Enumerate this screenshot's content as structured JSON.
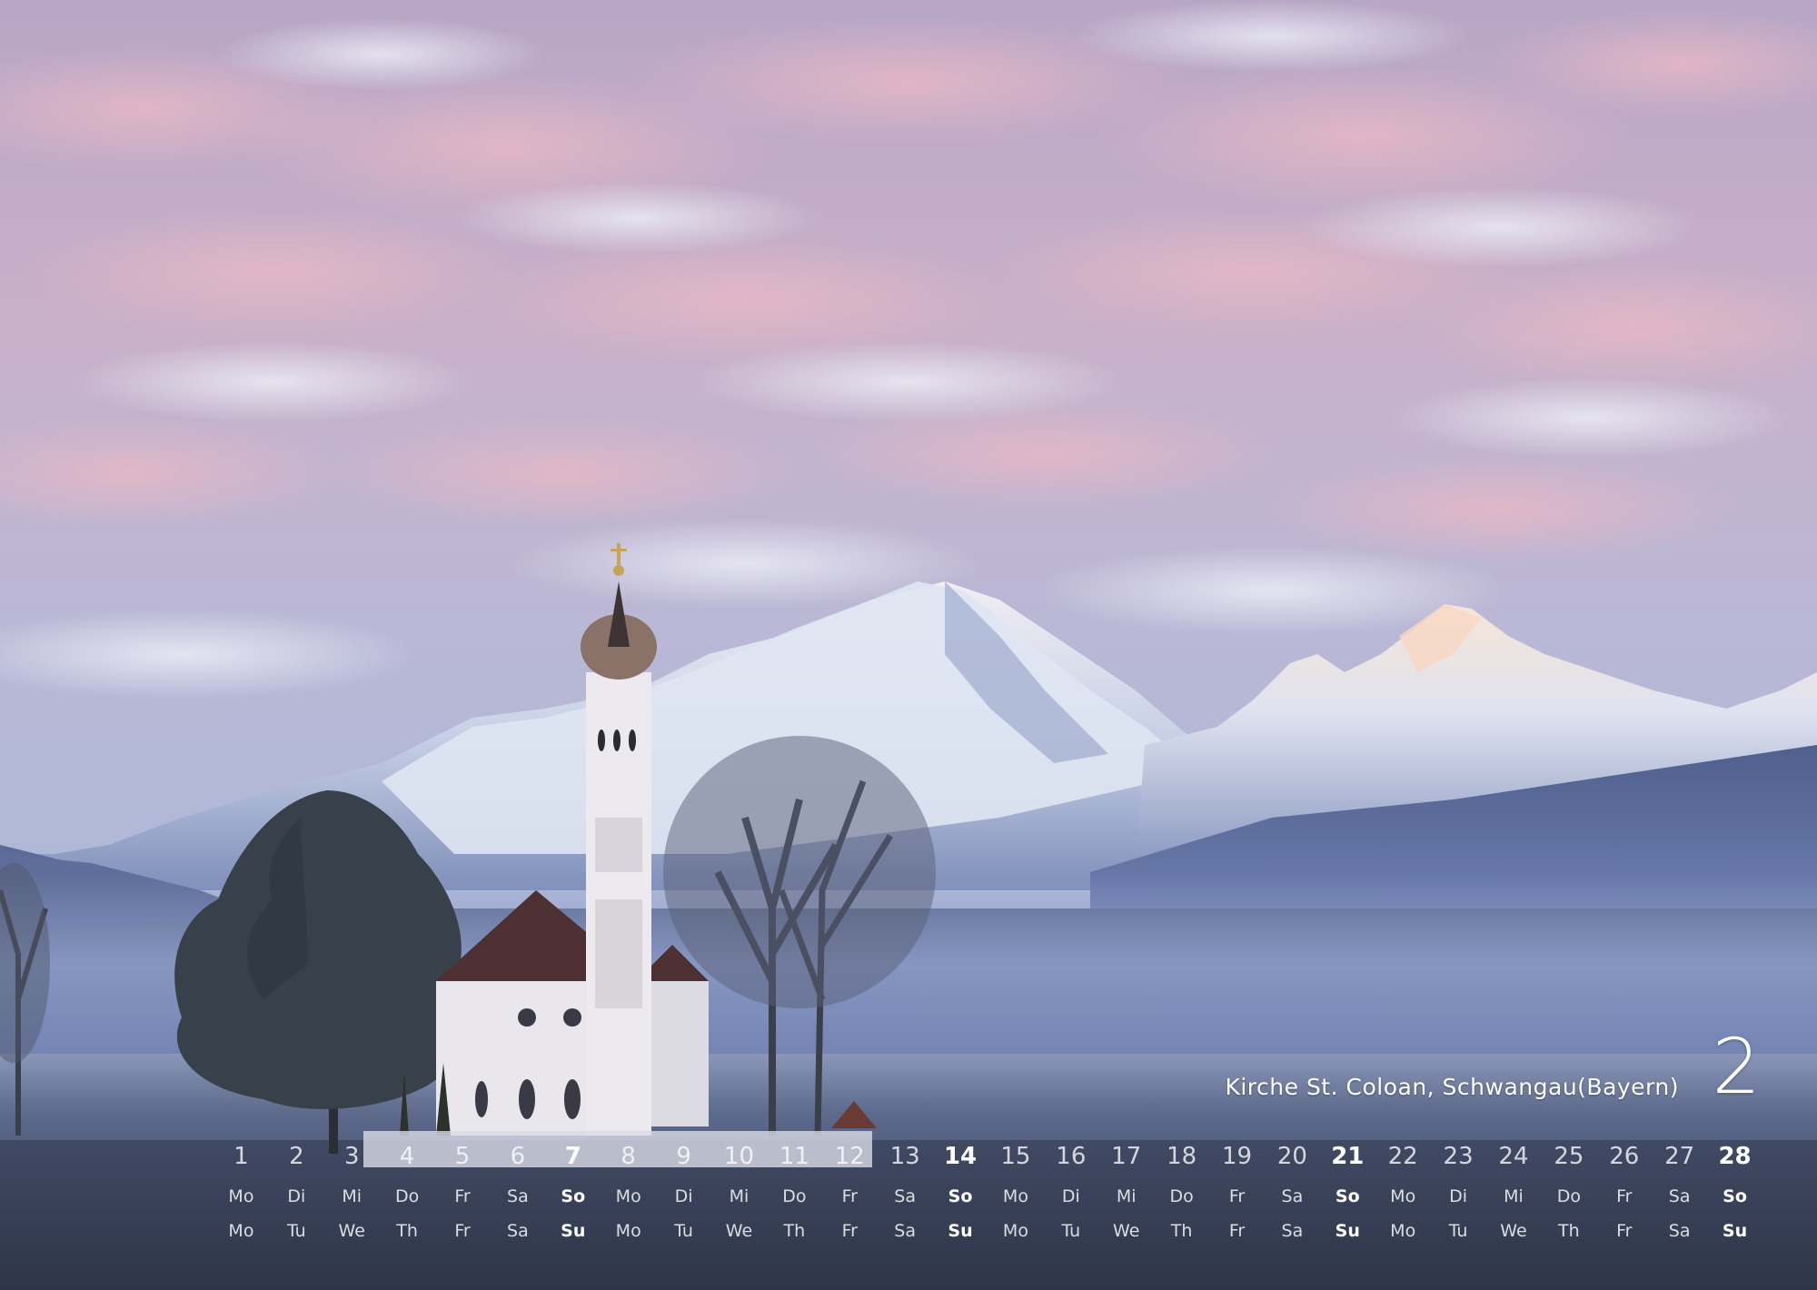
{
  "photo": {
    "caption": "Kirche St. Coloan, Schwangau(Bayern)"
  },
  "calendar": {
    "month_number": "2",
    "days": [
      "1",
      "2",
      "3",
      "4",
      "5",
      "6",
      "7",
      "8",
      "9",
      "10",
      "11",
      "12",
      "13",
      "14",
      "15",
      "16",
      "17",
      "18",
      "19",
      "20",
      "21",
      "22",
      "23",
      "24",
      "25",
      "26",
      "27",
      "28"
    ],
    "weekdays_de": [
      "Mo",
      "Di",
      "Mi",
      "Do",
      "Fr",
      "Sa",
      "So",
      "Mo",
      "Di",
      "Mi",
      "Do",
      "Fr",
      "Sa",
      "So",
      "Mo",
      "Di",
      "Mi",
      "Do",
      "Fr",
      "Sa",
      "So",
      "Mo",
      "Di",
      "Mi",
      "Do",
      "Fr",
      "Sa",
      "So"
    ],
    "weekdays_en": [
      "Mo",
      "Tu",
      "We",
      "Th",
      "Fr",
      "Sa",
      "Su",
      "Mo",
      "Tu",
      "We",
      "Th",
      "Fr",
      "Sa",
      "Su",
      "Mo",
      "Tu",
      "We",
      "Th",
      "Fr",
      "Sa",
      "Su",
      "Mo",
      "Tu",
      "We",
      "Th",
      "Fr",
      "Sa",
      "Su"
    ]
  },
  "colors": {
    "sky_top": "#b3a4c4",
    "sky_pink": "#d9b3c6",
    "mountain_snow": "#e8edf5",
    "mist": "#8fa1c8",
    "ground": "#3c4660",
    "text": "#ffffff"
  }
}
